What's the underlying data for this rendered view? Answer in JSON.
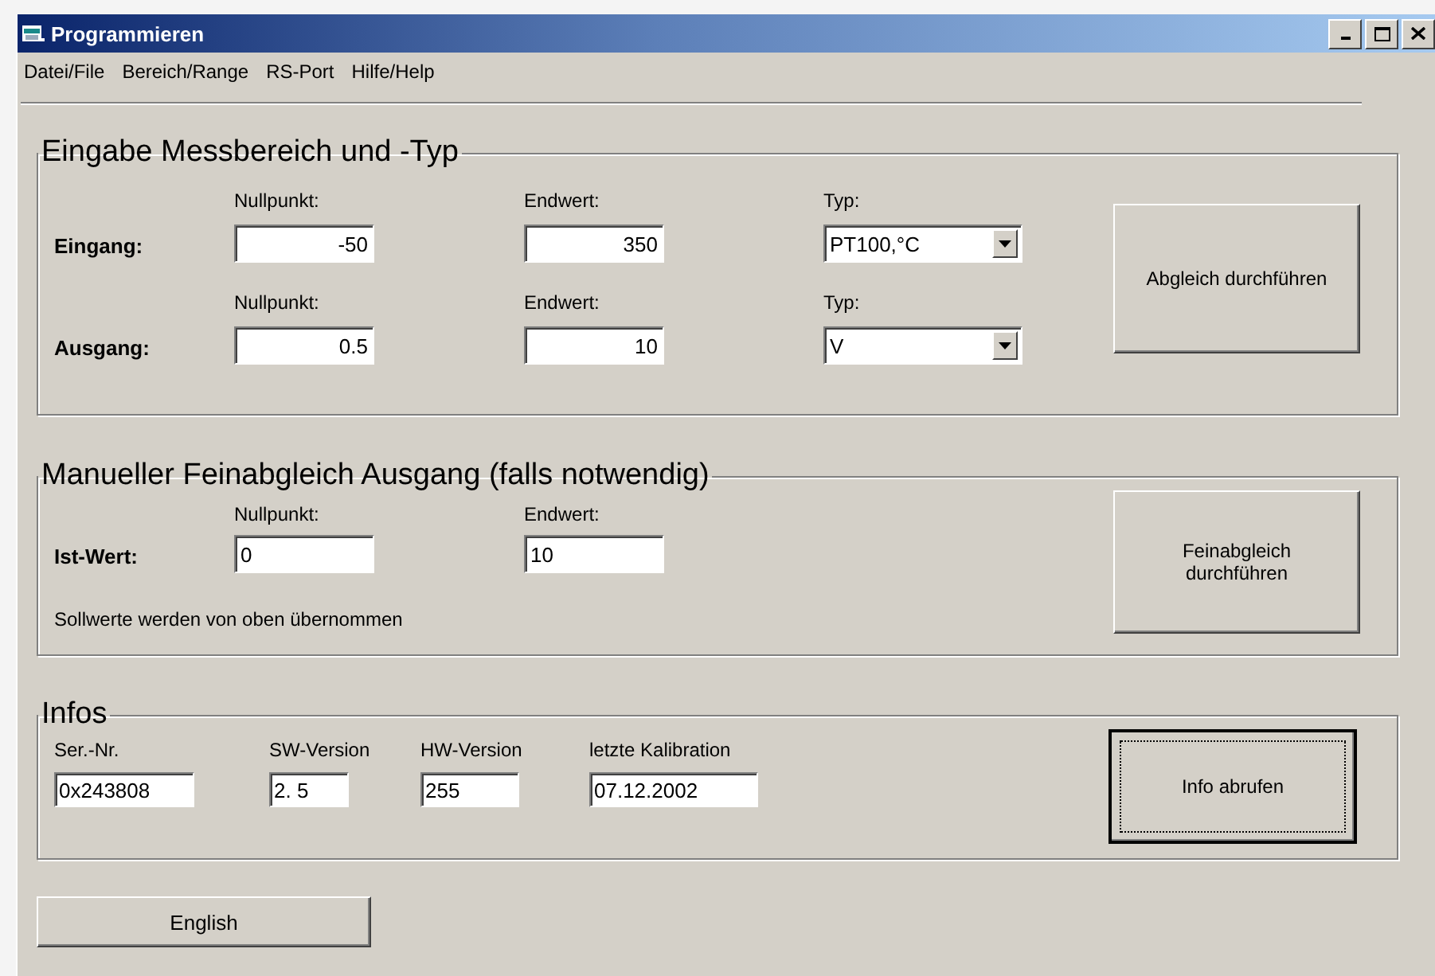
{
  "window": {
    "title": "Programmieren"
  },
  "menu": [
    "Datei/File",
    "Bereich/Range",
    "RS-Port",
    "Hilfe/Help"
  ],
  "range_group": {
    "title": "Eingabe Messbereich und -Typ",
    "button": "Abgleich durchführen",
    "rows": [
      {
        "label": "Eingang:",
        "zero_label": "Nullpunkt:",
        "zero": "-50",
        "end_label": "Endwert:",
        "end": "350",
        "type_label": "Typ:",
        "type": "PT100,°C"
      },
      {
        "label": "Ausgang:",
        "zero_label": "Nullpunkt:",
        "zero": "0.5",
        "end_label": "Endwert:",
        "end": "10",
        "type_label": "Typ:",
        "type": "V"
      }
    ]
  },
  "fine_group": {
    "title": "Manueller Feinabgleich Ausgang (falls notwendig)",
    "row_label": "Ist-Wert:",
    "zero_label": "Nullpunkt:",
    "zero": "0",
    "end_label": "Endwert:",
    "end": "10",
    "note": "Sollwerte werden von oben übernommen",
    "button": "Feinabgleich durchführen"
  },
  "info_group": {
    "title": "Infos",
    "button": "Info abrufen",
    "button_focused": true,
    "fields": [
      {
        "label": "Ser.-Nr.",
        "value": "0x243808"
      },
      {
        "label": "SW-Version",
        "value": "2. 5"
      },
      {
        "label": "HW-Version",
        "value": "255"
      },
      {
        "label": "letzte Kalibration",
        "value": "07.12.2002"
      }
    ]
  },
  "language_button": "English"
}
